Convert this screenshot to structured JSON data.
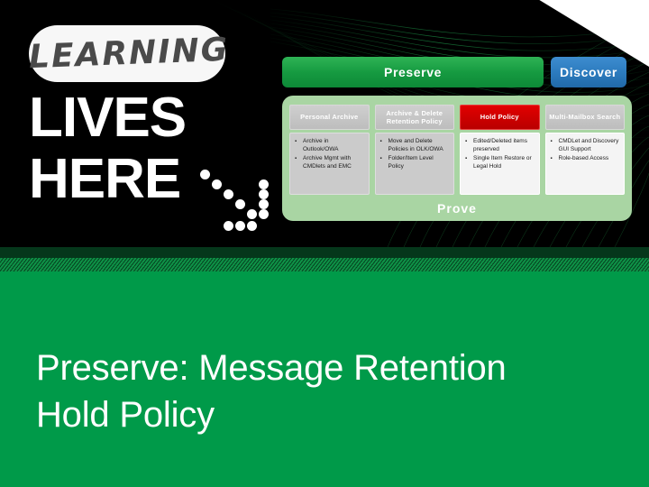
{
  "logo": {
    "pill_text": "LEARNING",
    "line1": "LIVES",
    "line2": "HERE",
    "dots_icon": "dotted-chevron-icon"
  },
  "header": {
    "preserve_label": "Preserve",
    "discover_label": "Discover"
  },
  "panel": {
    "footer_label": "Prove"
  },
  "cards": [
    {
      "head": "Personal Archive",
      "head_tone": "grey",
      "body_tone": "tone-grey",
      "bullets": [
        "Archive in Outlook/OWA",
        "Archive Mgmt with CMDlets and EMC"
      ]
    },
    {
      "head": "Archive & Delete Retention Policy",
      "head_tone": "grey",
      "body_tone": "tone-grey",
      "bullets": [
        "Move and Delete Policies in OLK/OWA",
        "Folder/Item Level Policy"
      ]
    },
    {
      "head": "Hold Policy",
      "head_tone": "red",
      "body_tone": "tone-white",
      "bullets": [
        "Edited/Deleted items preserved",
        "Single Item Restore or Legal Hold"
      ]
    },
    {
      "head": "Multi-Mailbox Search",
      "head_tone": "grey",
      "body_tone": "tone-white",
      "bullets": [
        "CMDLet and Discovery GUI Support",
        "Role-based Access"
      ]
    }
  ],
  "title": {
    "line1": "Preserve: Message Retention",
    "line2": "Hold Policy"
  },
  "colors": {
    "slide_green": "#009A49",
    "preserve_green": "#169B41",
    "discover_blue": "#2C7CBF",
    "hold_policy_red": "#C00000",
    "panel_light_green": "#A9D5A3",
    "card_head_grey": "#C4C4C4",
    "black": "#000000",
    "white": "#FFFFFF"
  }
}
